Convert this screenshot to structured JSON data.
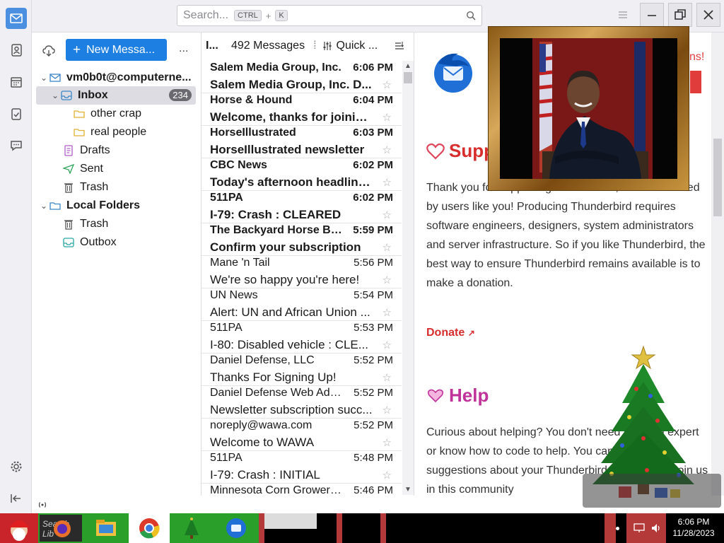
{
  "search": {
    "placeholder": "Search...",
    "shortcut_mod": "CTRL",
    "shortcut_plus": "+",
    "shortcut_key": "K"
  },
  "folder_pane": {
    "new_message_label": "New Messa...",
    "more_label": "...",
    "account": "vm0b0t@computerne...",
    "folders": [
      {
        "name": "Inbox",
        "count": "234"
      },
      {
        "name": "other crap"
      },
      {
        "name": "real people"
      },
      {
        "name": "Drafts"
      },
      {
        "name": "Sent"
      },
      {
        "name": "Trash"
      }
    ],
    "local_folders": "Local Folders",
    "local": [
      {
        "name": "Trash"
      },
      {
        "name": "Outbox"
      }
    ]
  },
  "list": {
    "header_short": "I...",
    "count_label": "492 Messages",
    "quick_filter": "Quick ...",
    "messages": [
      {
        "sender": "Salem Media Group, Inc.",
        "date": "6:06 PM",
        "subject": "Salem Media Group, Inc. D...",
        "unread": true
      },
      {
        "sender": "Horse & Hound",
        "date": "6:04 PM",
        "subject": "Welcome, thanks for joining...",
        "unread": true
      },
      {
        "sender": "HorseIllustrated",
        "date": "6:03 PM",
        "subject": "HorseIllustrated newsletter",
        "unread": true
      },
      {
        "sender": "CBC News",
        "date": "6:02 PM",
        "subject": "Today's afternoon headline...",
        "unread": true
      },
      {
        "sender": "511PA",
        "date": "6:02 PM",
        "subject": "I-79: Crash : CLEARED",
        "unread": true
      },
      {
        "sender": "The Backyard Horse Blog",
        "date": "5:59 PM",
        "subject": "Confirm your subscription",
        "unread": true
      },
      {
        "sender": "Mane 'n Tail",
        "date": "5:56 PM",
        "subject": "We're so happy you're here!",
        "unread": false
      },
      {
        "sender": "UN News",
        "date": "5:54 PM",
        "subject": "Alert: UN and African Union ...",
        "unread": false
      },
      {
        "sender": "511PA",
        "date": "5:53 PM",
        "subject": "I-80: Disabled vehicle : CLE...",
        "unread": false
      },
      {
        "sender": "Daniel Defense, LLC",
        "date": "5:52 PM",
        "subject": "Thanks For Signing Up!",
        "unread": false
      },
      {
        "sender": "Daniel Defense Web Admin",
        "date": "5:52 PM",
        "subject": "Newsletter subscription succ...",
        "unread": false
      },
      {
        "sender": "noreply@wawa.com",
        "date": "5:52 PM",
        "subject": "Welcome to WAWA",
        "unread": false
      },
      {
        "sender": "511PA",
        "date": "5:48 PM",
        "subject": "I-79: Crash : INITIAL",
        "unread": false
      },
      {
        "sender": "Minnesota Corn Growers ...",
        "date": "5:46 PM",
        "subject": "",
        "unread": false
      }
    ]
  },
  "reading": {
    "support_title": "Supp",
    "support_text": "Thank you for supporting Thunderbird, which is funded by users like you! Producing Thunderbird requires software engineers, designers, system administrators and server infrastructure. So if you like Thunderbird, the best way to ensure Thunderbird remains available is to make a donation.",
    "donate_label": "Donate",
    "help_title": "Help",
    "help_text": "Curious about helping? You don't need to be an expert or know how to code to help. You can test or offer suggestions about your Thunderbird experience! Join us in this community",
    "partial_red": "ns!"
  },
  "taskbar": {
    "time": "6:06 PM",
    "date": "11/28/2023",
    "search_label": "Search Lib"
  },
  "colors": {
    "accent": "#1d7fe2",
    "donate": "#d72d2d",
    "help": "#c0339b",
    "support_heart": "#e0475e"
  }
}
